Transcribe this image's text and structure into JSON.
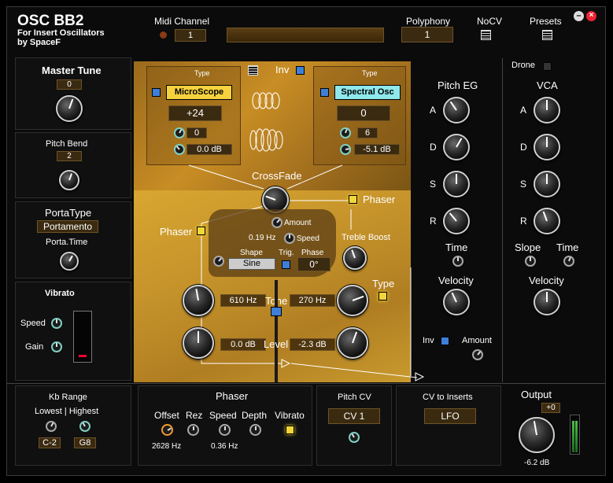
{
  "header": {
    "title": "OSC BB2",
    "subtitle1": "For Insert Oscillators",
    "subtitle2": "by SpaceF",
    "midi_label": "Midi Channel",
    "midi_value": "1",
    "poly_label": "Polyphony",
    "poly_value": "1",
    "nocv_label": "NoCV",
    "presets_label": "Presets"
  },
  "left": {
    "master_tune_label": "Master Tune",
    "master_tune_value": "0",
    "pitch_bend_label": "Pitch Bend",
    "pitch_bend_value": "2",
    "porta_type_label": "PortaType",
    "porta_type_value": "Portamento",
    "porta_time_label": "Porta.Time",
    "vibrato_label": "Vibrato",
    "speed_label": "Speed",
    "gain_label": "Gain"
  },
  "osc": {
    "inv_label": "Inv",
    "a": {
      "type_label": "Type",
      "type_value": "MicroScope",
      "semi": "+24",
      "fine": "0",
      "level": "0.0 dB"
    },
    "b": {
      "type_label": "Type",
      "type_value": "Spectral Osc",
      "semi": "0",
      "fine": "6",
      "level": "-5.1 dB"
    },
    "crossfade_label": "CrossFade",
    "phaser_left_label": "Phaser",
    "phaser_right_label": "Phaser",
    "amount_label": "Amount",
    "speed_value": "0.19 Hz",
    "speed_label": "Speed",
    "shape_label": "Shape",
    "shape_value": "Sine",
    "trig_label": "Trig.",
    "phase_label": "Phase",
    "phase_value": "0°",
    "treble_label": "Treble Boost",
    "type_label": "Type",
    "tone_label": "Tone",
    "tone_left": "610 Hz",
    "tone_right": "270 Hz",
    "level_label": "Level",
    "level_left": "0.0 dB",
    "level_right": "-2.3 dB"
  },
  "pitch_eg": {
    "title": "Pitch EG",
    "a": "A",
    "d": "D",
    "s": "S",
    "r": "R",
    "time_label": "Time",
    "velocity_label": "Velocity",
    "inv_label": "Inv",
    "amount_label": "Amount"
  },
  "vca": {
    "drone_label": "Drone",
    "title": "VCA",
    "a": "A",
    "d": "D",
    "s": "S",
    "r": "R",
    "slope_label": "Slope",
    "time_label": "Time",
    "velocity_label": "Velocity"
  },
  "bottom": {
    "kb_range_label": "Kb Range",
    "lowest_highest_label": "Lowest | Highest",
    "lowest_value": "C-2",
    "highest_value": "G8",
    "phaser_title": "Phaser",
    "offset_label": "Offset",
    "rez_label": "Rez",
    "speed_label": "Speed",
    "depth_label": "Depth",
    "vibrato_label": "Vibrato",
    "offset_value": "2628 Hz",
    "speed_value": "0.36 Hz",
    "pitch_cv_label": "Pitch CV",
    "pitch_cv_value": "CV 1",
    "cv_inserts_label": "CV to Inserts",
    "cv_inserts_value": "LFO",
    "output_label": "Output",
    "output_offset": "+0",
    "output_value": "-6.2 dB"
  }
}
